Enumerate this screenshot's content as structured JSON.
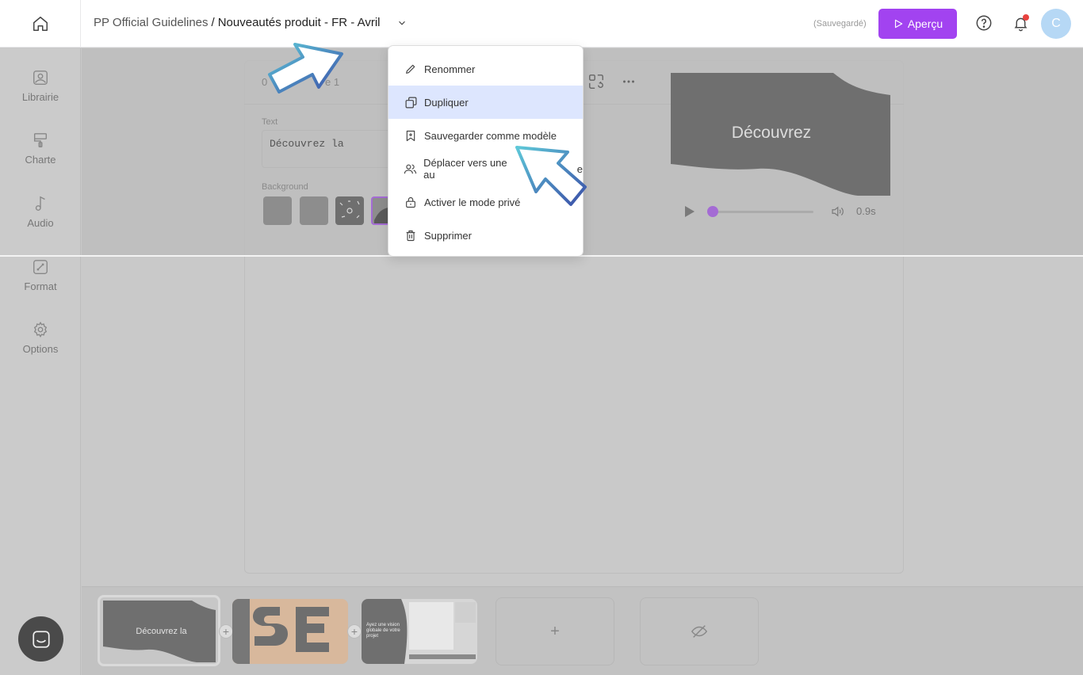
{
  "topbar": {
    "breadcrumb_project": "PP Official Guidelines",
    "breadcrumb_separator": "/",
    "breadcrumb_page": "Nouveautés produit - FR - Avril",
    "save_status": "(Sauvegardé)",
    "preview_label": "Aperçu",
    "avatar_initial": "C"
  },
  "sidebar": {
    "items": [
      {
        "label": "Librairie",
        "icon": "image-icon"
      },
      {
        "label": "Charte",
        "icon": "paint-roller-icon"
      },
      {
        "label": "Audio",
        "icon": "music-note-icon"
      },
      {
        "label": "Format",
        "icon": "resize-icon"
      },
      {
        "label": "Options",
        "icon": "gear-icon"
      }
    ]
  },
  "editor": {
    "slide_label_partial_start": "0",
    "slide_label_partial_end": "e 1",
    "text_label": "Text",
    "text_value": "Découvrez la",
    "background_label": "Background",
    "preview_text": "Découvrez",
    "duration": "0.9s",
    "playback_progress": 0.0
  },
  "menu": {
    "items": [
      {
        "label": "Renommer",
        "icon": "pencil-icon"
      },
      {
        "label": "Dupliquer",
        "icon": "duplicate-icon",
        "active": true
      },
      {
        "label": "Sauvegarder comme modèle",
        "icon": "bookmark-plus-icon"
      },
      {
        "label": "Déplacer vers une au",
        "label_end": "e",
        "icon": "users-icon"
      },
      {
        "label": "Activer le mode privé",
        "icon": "lock-icon"
      },
      {
        "label": "Supprimer",
        "icon": "trash-icon"
      }
    ]
  },
  "filmstrip": {
    "thumb1_text": "Découvrez la",
    "thumb3_text": "Ayez une vision globale de votre projet",
    "add_label": "+"
  },
  "colors": {
    "accent": "#a243f0",
    "menu_active": "#dde6fe",
    "notification_dot": "#e8423f",
    "avatar": "#b6d8f5"
  }
}
